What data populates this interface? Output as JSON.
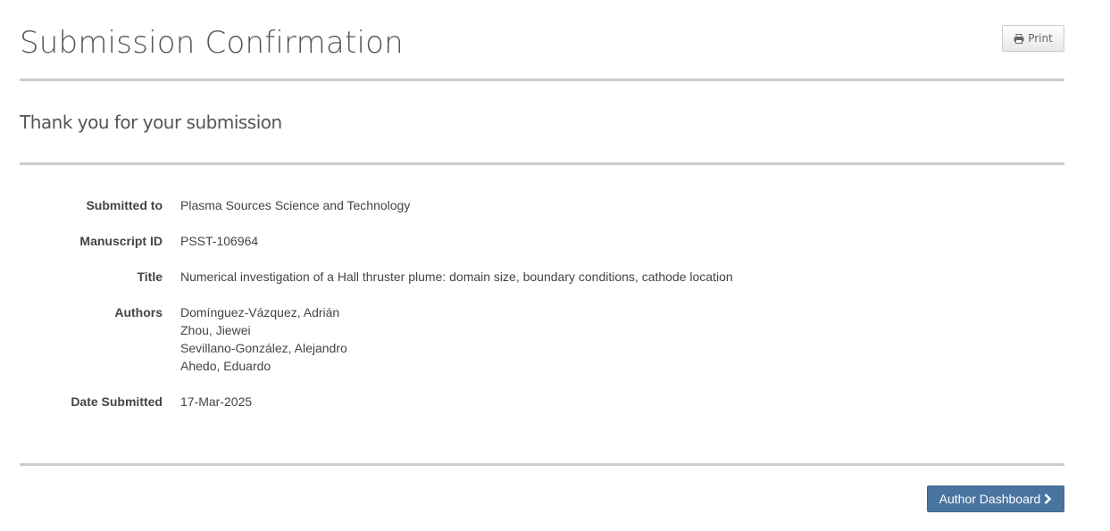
{
  "header": {
    "title": "Submission Confirmation",
    "print_label": "Print",
    "print_icon": "print-icon"
  },
  "subtitle": "Thank you for your submission",
  "details": {
    "submitted_to": {
      "label": "Submitted to",
      "value": "Plasma Sources Science and Technology"
    },
    "manuscript_id": {
      "label": "Manuscript ID",
      "value": "PSST-106964"
    },
    "title": {
      "label": "Title",
      "value": "Numerical investigation of a Hall thruster plume: domain size, boundary conditions, cathode location"
    },
    "authors": {
      "label": "Authors",
      "values": [
        "Domínguez-Vázquez, Adrián",
        "Zhou, Jiewei",
        "Sevillano-González, Alejandro",
        "Ahedo, Eduardo"
      ]
    },
    "date_submitted": {
      "label": "Date Submitted",
      "value": "17-Mar-2025"
    }
  },
  "footer": {
    "dashboard_label": "Author Dashboard",
    "dashboard_icon": "chevron-right-icon"
  },
  "colors": {
    "primary_button": "#4a74a0",
    "rule": "#cccccc",
    "title_text": "#555555"
  }
}
